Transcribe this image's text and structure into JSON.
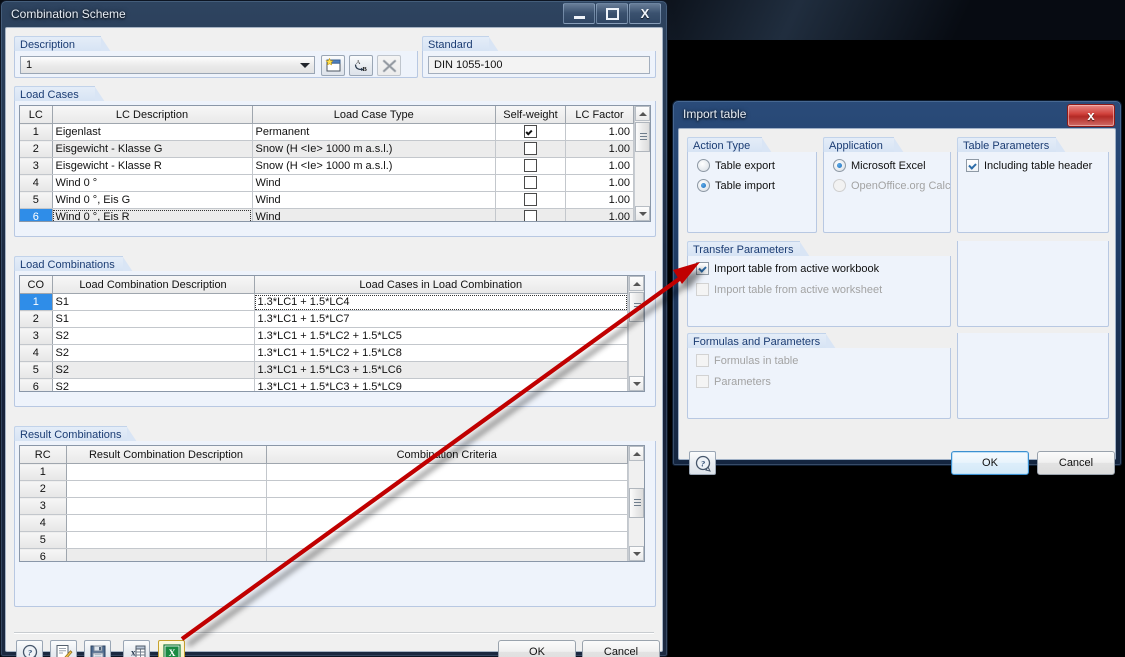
{
  "main_window": {
    "title": "Combination Scheme",
    "caption_buttons": [
      {
        "name": "minimize",
        "glyph": "minimize-icon"
      },
      {
        "name": "maximize",
        "glyph": "maximize-icon"
      },
      {
        "name": "close",
        "glyph": "close-icon",
        "label": "X"
      }
    ],
    "description_group": {
      "title": "Description",
      "combo_value": "1",
      "buttons": [
        {
          "name": "new-scheme",
          "icon": "new-window-icon"
        },
        {
          "name": "rename-scheme",
          "icon": "rename-ab-icon"
        },
        {
          "name": "delete-scheme",
          "icon": "delete-x-icon",
          "disabled": true
        }
      ]
    },
    "standard_group": {
      "title": "Standard",
      "value": "DIN 1055-100"
    },
    "load_cases": {
      "title": "Load Cases",
      "columns": [
        "LC",
        "LC Description",
        "Load Case Type",
        "Self-weight",
        "LC Factor"
      ],
      "rows": [
        {
          "lc": "1",
          "desc": "Eigenlast",
          "type": "Permanent",
          "selfweight": true,
          "factor": "1.00"
        },
        {
          "lc": "2",
          "desc": "Eisgewicht - Klasse G",
          "type": "Snow (H <Ie> 1000 m a.s.l.)",
          "selfweight": false,
          "factor": "1.00"
        },
        {
          "lc": "3",
          "desc": "Eisgewicht - Klasse R",
          "type": "Snow (H <Ie> 1000 m a.s.l.)",
          "selfweight": false,
          "factor": "1.00"
        },
        {
          "lc": "4",
          "desc": "Wind 0 °",
          "type": "Wind",
          "selfweight": false,
          "factor": "1.00"
        },
        {
          "lc": "5",
          "desc": "Wind 0 °, Eis G",
          "type": "Wind",
          "selfweight": false,
          "factor": "1.00"
        },
        {
          "lc": "6",
          "desc": "Wind 0 °, Eis R",
          "type": "Wind",
          "selfweight": false,
          "factor": "1.00"
        }
      ],
      "selected_row": 6
    },
    "load_combinations": {
      "title": "Load Combinations",
      "columns": [
        "CO",
        "Load Combination Description",
        "Load Cases in Load Combination"
      ],
      "rows": [
        {
          "co": "1",
          "desc": "S1",
          "cases": "1.3*LC1 + 1.5*LC4"
        },
        {
          "co": "2",
          "desc": "S1",
          "cases": "1.3*LC1 + 1.5*LC7"
        },
        {
          "co": "3",
          "desc": "S2",
          "cases": "1.3*LC1 + 1.5*LC2 + 1.5*LC5"
        },
        {
          "co": "4",
          "desc": "S2",
          "cases": "1.3*LC1 + 1.5*LC2 + 1.5*LC8"
        },
        {
          "co": "5",
          "desc": "S2",
          "cases": "1.3*LC1 + 1.5*LC3 + 1.5*LC6"
        },
        {
          "co": "6",
          "desc": "S2",
          "cases": "1.3*LC1 + 1.5*LC3 + 1.5*LC9"
        }
      ],
      "selected_row": 1
    },
    "result_combinations": {
      "title": "Result Combinations",
      "columns": [
        "RC",
        "Result Combination Description",
        "Combination Criteria"
      ],
      "rows": [
        {
          "rc": "1",
          "desc": "",
          "criteria": ""
        },
        {
          "rc": "2",
          "desc": "",
          "criteria": ""
        },
        {
          "rc": "3",
          "desc": "",
          "criteria": ""
        },
        {
          "rc": "4",
          "desc": "",
          "criteria": ""
        },
        {
          "rc": "5",
          "desc": "",
          "criteria": ""
        },
        {
          "rc": "6",
          "desc": "",
          "criteria": ""
        }
      ]
    },
    "footer_toolbar": [
      {
        "name": "help-button",
        "icon": "help-question-icon"
      },
      {
        "name": "edit-button",
        "icon": "edit-pencil-icon"
      },
      {
        "name": "save-button",
        "icon": "floppy-save-icon"
      },
      {
        "name": "table-export-button",
        "icon": "table-export-icon"
      },
      {
        "name": "excel-button",
        "icon": "excel-icon",
        "selected": true
      }
    ],
    "ok_label": "OK",
    "cancel_label": "Cancel"
  },
  "import_dialog": {
    "title": "Import table",
    "close_label": "x",
    "action_type": {
      "title": "Action Type",
      "options": [
        {
          "label": "Table export",
          "selected": false,
          "disabled": false
        },
        {
          "label": "Table import",
          "selected": true,
          "disabled": false
        }
      ]
    },
    "application": {
      "title": "Application",
      "options": [
        {
          "label": "Microsoft Excel",
          "selected": true,
          "disabled": false
        },
        {
          "label": "OpenOffice.org Calc",
          "selected": false,
          "disabled": true
        }
      ]
    },
    "table_parameters": {
      "title": "Table Parameters",
      "options": [
        {
          "label": "Including table header",
          "checked": true,
          "disabled": false
        }
      ]
    },
    "transfer_parameters": {
      "title": "Transfer Parameters",
      "options": [
        {
          "label": "Import table from active workbook",
          "checked": true,
          "disabled": false
        },
        {
          "label": "Import table from active worksheet",
          "checked": false,
          "disabled": true
        }
      ]
    },
    "formulas_parameters": {
      "title": "Formulas and Parameters",
      "options": [
        {
          "label": "Formulas in table",
          "checked": false,
          "disabled": true
        },
        {
          "label": "Parameters",
          "checked": false,
          "disabled": true
        }
      ]
    },
    "help_button": {
      "name": "help-button",
      "icon": "help-question-icon"
    },
    "ok_label": "OK",
    "cancel_label": "Cancel"
  },
  "annotation": {
    "type": "arrow",
    "color": "#c00000",
    "from_label": "excel-button",
    "to_label": "import-table-from-active-workbook-checkbox"
  },
  "colors": {
    "accent_blue": "#2f8de8",
    "group_title": "#1b3c73",
    "annotation_red": "#c00000",
    "excel_green": "#1a7a3c"
  }
}
